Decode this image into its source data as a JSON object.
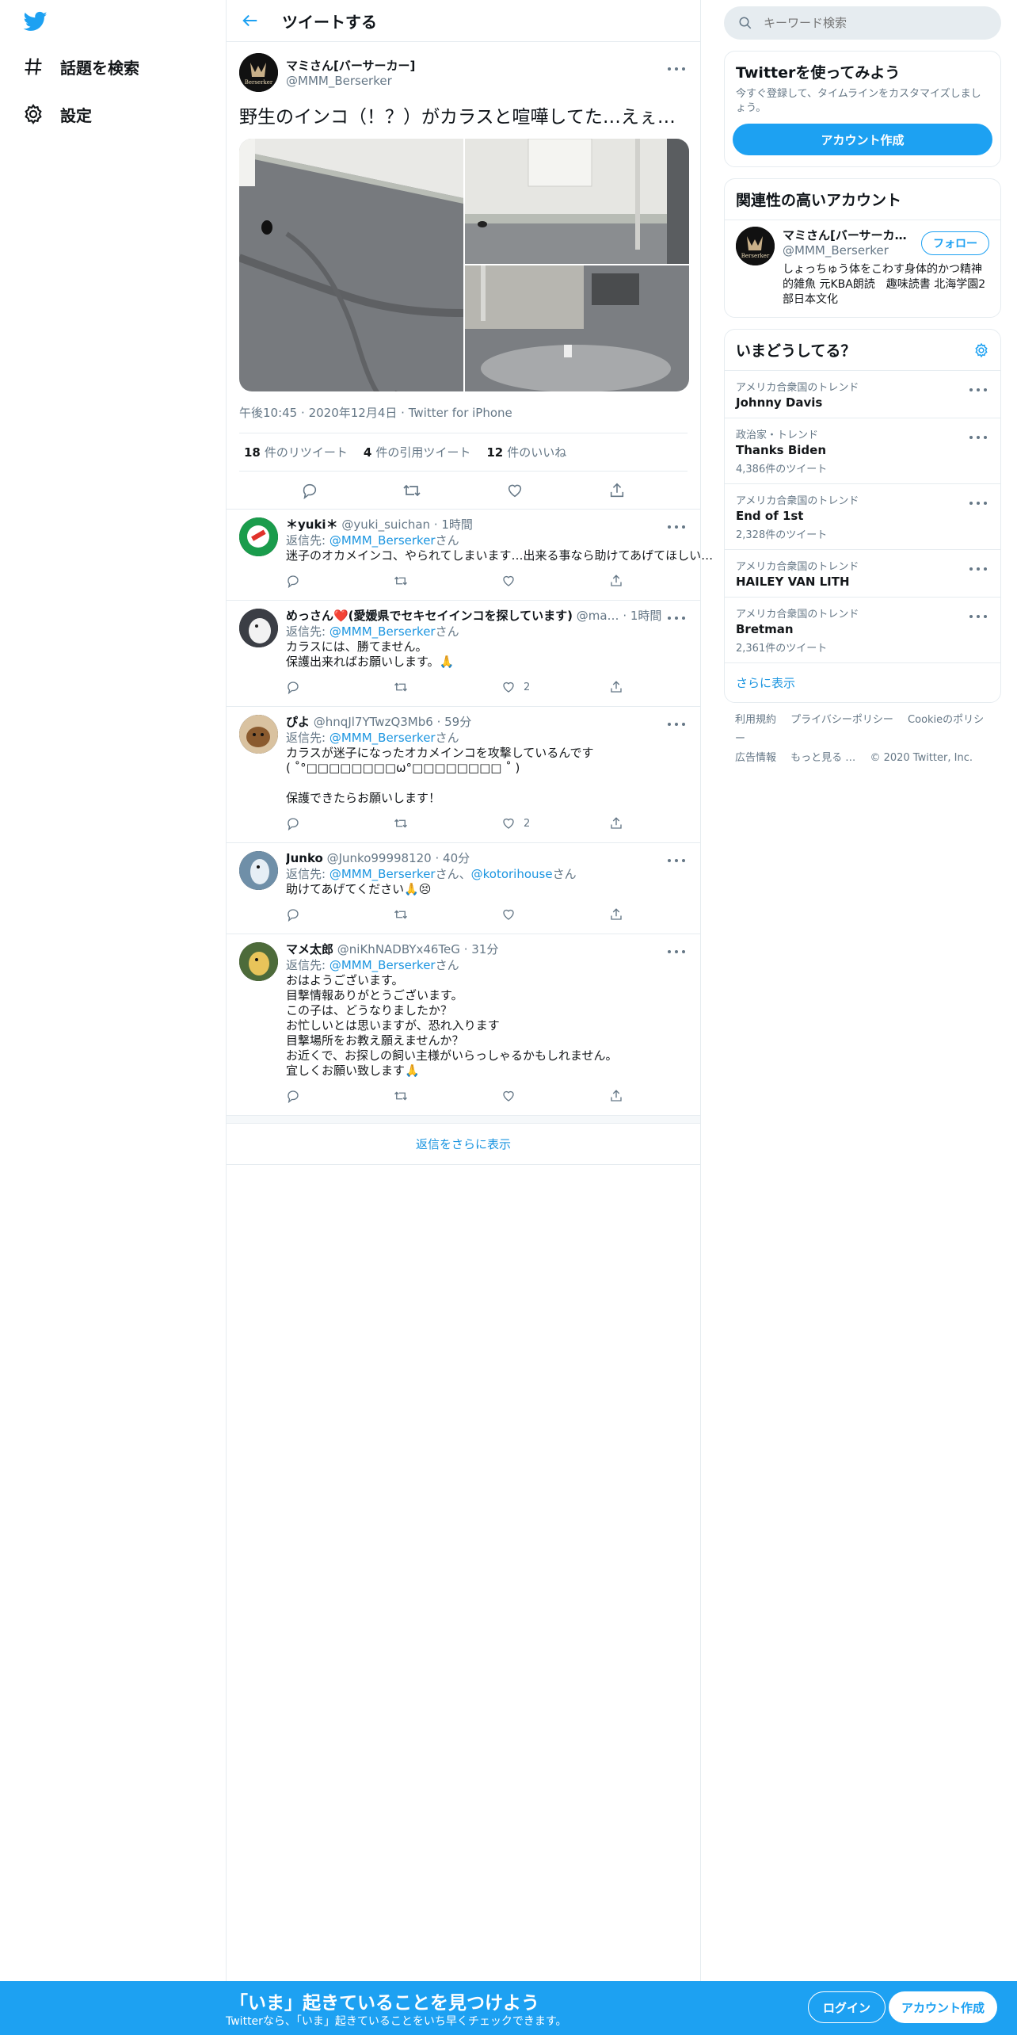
{
  "colors": {
    "accent": "#1da1f2",
    "link": "#1b95e0",
    "muted": "#657786",
    "border": "#e6ecf0"
  },
  "nav": {
    "logo_icon": "twitter-bird-icon",
    "items": [
      {
        "label": "話題を検索",
        "icon": "hashtag-icon"
      },
      {
        "label": "設定",
        "icon": "gear-icon"
      }
    ]
  },
  "header": {
    "title": "ツイートする",
    "back_icon": "back-arrow-icon"
  },
  "tweet": {
    "display_name": "マミさん[バーサーカー]",
    "username": "@MMM_Berserker",
    "avatar_text": "Berserker",
    "text": "野生のインコ（！？）がカラスと喧嘩してた…えぇ…",
    "meta": {
      "time": "午後10:45",
      "date": "2020年12月4日",
      "source": "Twitter for iPhone"
    },
    "stats": [
      {
        "count": "18",
        "label": "件のリツイート"
      },
      {
        "count": "4",
        "label": "件の引用ツイート"
      },
      {
        "count": "12",
        "label": "件のいいね"
      }
    ]
  },
  "replies": [
    {
      "display_name": "＊yuki＊",
      "username": "@yuki_suichan",
      "time": "1時間",
      "reply_prefix": "返信先: ",
      "reply_to": "@MMM_Berserker",
      "reply_suffix": "さん",
      "text": "迷子のオカメインコ、やられてしまいます…出来る事なら助けてあげてほしい…",
      "likes": ""
    },
    {
      "display_name": "めっさん❤️(愛媛県でセキセイインコを探しています)",
      "username": "@ma…",
      "time": "1時間",
      "reply_prefix": "返信先: ",
      "reply_to": "@MMM_Berserker",
      "reply_suffix": "さん",
      "text": "カラスには、勝てません。\n保護出来ればお願いします。🙏",
      "likes": "2"
    },
    {
      "display_name": "ぴよ",
      "username": "@hnqJl7YTwzQ3Mb6",
      "time": "59分",
      "reply_prefix": "返信先: ",
      "reply_to": "@MMM_Berserker",
      "reply_suffix": "さん",
      "text": "カラスが迷子になったオカメインコを攻撃しているんです\n( ˚°□□□□□□□□ω°□□□□□□□□ ˚ )\n\n保護できたらお願いします！",
      "likes": "2"
    },
    {
      "display_name": "Junko",
      "username": "@Junko99998120",
      "time": "40分",
      "reply_prefix": "返信先: ",
      "reply_to": "@MMM_Berserker",
      "reply_suffix": "さん、",
      "reply_to2": "@kotorihouse",
      "reply_suffix2": "さん",
      "text": "助けてあげてください🙏😣",
      "likes": ""
    },
    {
      "display_name": "マメ太郎",
      "username": "@niKhNADBYx46TeG",
      "time": "31分",
      "reply_prefix": "返信先: ",
      "reply_to": "@MMM_Berserker",
      "reply_suffix": "さん",
      "text": "おはようございます。\n目撃情報ありがとうございます。\nこの子は、どうなりましたか？\nお忙しいとは思いますが、恐れ入ります\n目撃場所をお教え願えませんか？\nお近くで、お探しの飼い主様がいらっしゃるかもしれません。\n宜しくお願い致します🙏",
      "likes": ""
    }
  ],
  "show_more_replies": "返信をさらに表示",
  "right": {
    "search_placeholder": "キーワード検索",
    "signup_card": {
      "title": "Twitterを使ってみよう",
      "subtitle": "今すぐ登録して、タイムラインをカスタマイズしましょう。",
      "button": "アカウント作成"
    },
    "related_card": {
      "title": "関連性の高いアカウント",
      "display_name": "マミさん[バーサーカー]",
      "username": "@MMM_Berserker",
      "follow": "フォロー",
      "bio": "しょっちゅう体をこわす身体的かつ精神的雑魚 元KBA朗読　趣味読書 北海学園2部日本文化"
    },
    "trends_card": {
      "title": "いまどうしてる？",
      "trends": [
        {
          "context": "アメリカ合衆国のトレンド",
          "name": "Johnny Davis",
          "count": ""
        },
        {
          "context": "政治家・トレンド",
          "name": "Thanks Biden",
          "count": "4,386件のツイート"
        },
        {
          "context": "アメリカ合衆国のトレンド",
          "name": "End of 1st",
          "count": "2,328件のツイート"
        },
        {
          "context": "アメリカ合衆国のトレンド",
          "name": "HAILEY VAN LITH",
          "count": ""
        },
        {
          "context": "アメリカ合衆国のトレンド",
          "name": "Bretman",
          "count": "2,361件のツイート"
        }
      ],
      "show_more": "さらに表示"
    },
    "footer": {
      "links": [
        "利用規約",
        "プライバシーポリシー",
        "Cookieのポリシー",
        "広告情報",
        "もっと見る …"
      ],
      "copyright": "© 2020 Twitter, Inc."
    }
  },
  "banner": {
    "title": "「いま」起きていることを見つけよう",
    "subtitle": "Twitterなら、「いま」起きていることをいち早くチェックできます。",
    "login": "ログイン",
    "signup": "アカウント作成"
  }
}
